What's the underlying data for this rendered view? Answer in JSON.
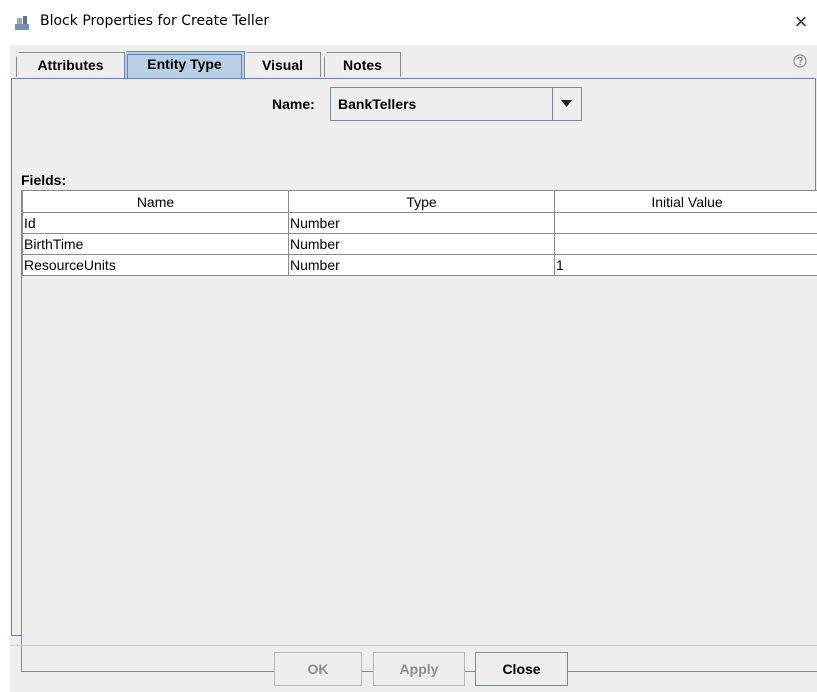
{
  "window": {
    "title": "Block Properties for Create Teller",
    "close_glyph": "×"
  },
  "icons": {
    "app": "block-properties-icon",
    "close": "close-icon",
    "help": "help-icon",
    "dropdown": "chevron-down-icon"
  },
  "tabs": [
    {
      "label": "Attributes",
      "active": false
    },
    {
      "label": "Entity Type",
      "active": true
    },
    {
      "label": "Visual",
      "active": false
    },
    {
      "label": "Notes",
      "active": false
    }
  ],
  "entity_type": {
    "name_label": "Name:",
    "name_value": "BankTellers",
    "fields_label": "Fields:",
    "columns": [
      "Name",
      "Type",
      "Initial Value"
    ],
    "rows": [
      [
        "Id",
        "Number",
        ""
      ],
      [
        "BirthTime",
        "Number",
        ""
      ],
      [
        "ResourceUnits",
        "Number",
        "1"
      ]
    ]
  },
  "buttons": {
    "ok": {
      "label": "OK",
      "enabled": false
    },
    "apply": {
      "label": "Apply",
      "enabled": false
    },
    "close": {
      "label": "Close",
      "enabled": true
    }
  },
  "colors": {
    "active_tab": "#b8cfe5",
    "focus_border": "#6382bf",
    "panel_bg": "#eeeeee"
  }
}
